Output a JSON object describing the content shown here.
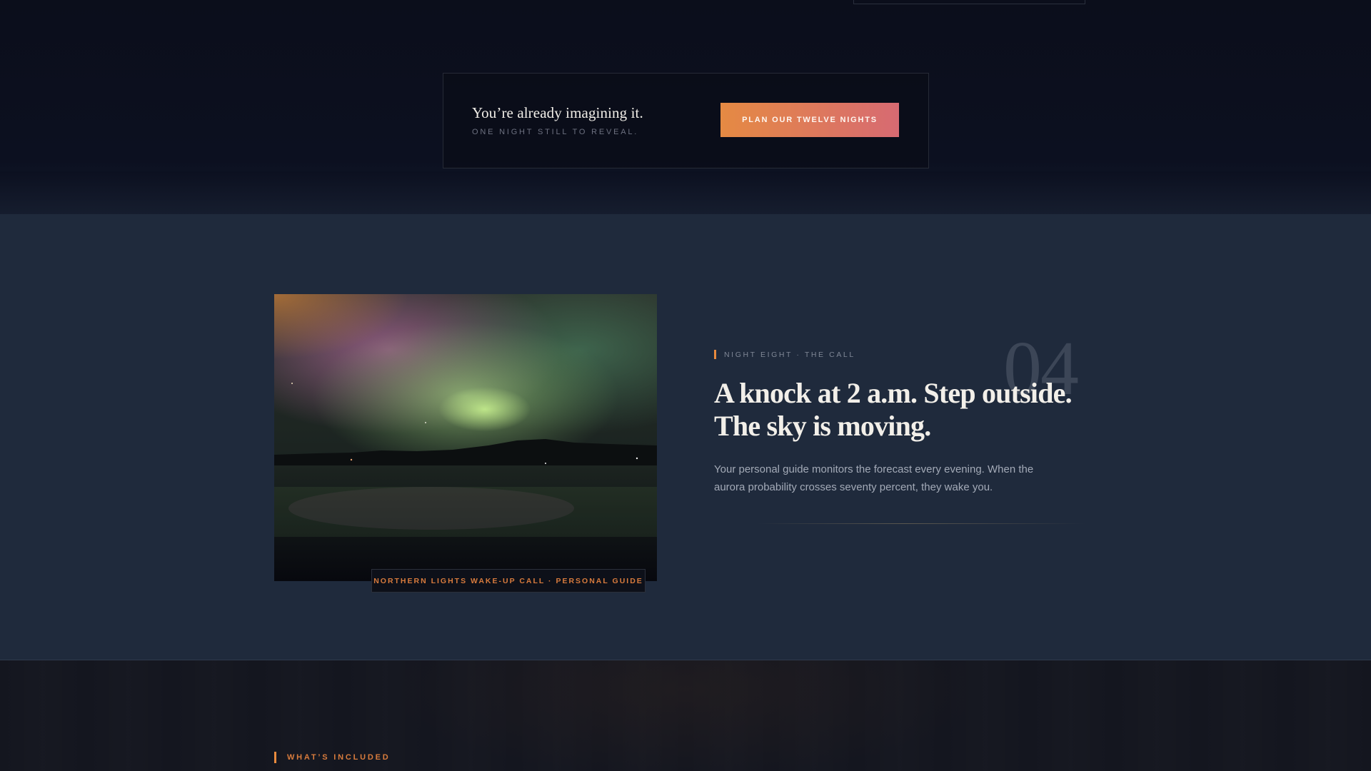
{
  "teaser": {
    "title": "You’re already imagining it.",
    "subtitle": "ONE NIGHT STILL TO REVEAL.",
    "cta_label": "PLAN OUR TWELVE NIGHTS"
  },
  "night": {
    "number": "04",
    "eyebrow": "NIGHT EIGHT · THE CALL",
    "headline_line1": "A knock at 2 a.m. Step outside.",
    "headline_line2": "The sky is moving.",
    "body": "Your personal guide monitors the forecast every evening. When the aurora probability crosses seventy percent, they wake you.",
    "photo_caption": "NORTHERN LIGHTS WAKE-UP CALL · PERSONAL GUIDE"
  },
  "included": {
    "eyebrow": "WHAT’S INCLUDED"
  },
  "colors": {
    "accent": "#e88a3e",
    "cta_gradient_start": "#e58a43",
    "cta_gradient_end": "#d76a72",
    "night_bg": "#1f2a3c",
    "page_bg": "#0b0e1b"
  },
  "icons": {
    "photo_subject": "aurora-borealis-image"
  }
}
